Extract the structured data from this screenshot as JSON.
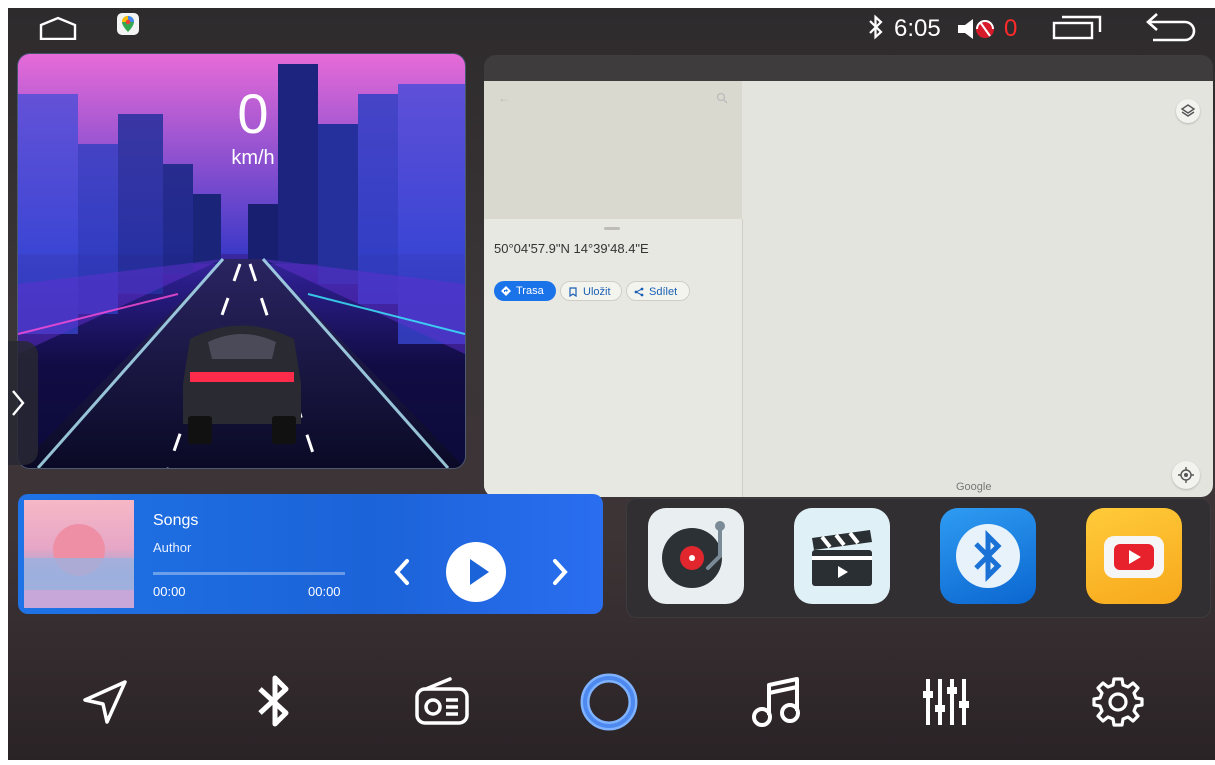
{
  "status_bar": {
    "time": "6:05",
    "volume_level": "0"
  },
  "speedometer": {
    "speed": "0",
    "unit": "km/h"
  },
  "map": {
    "coordinates": "50°04'57.9\"N 14°39'48.4\"E",
    "actions": {
      "route": "Trasa",
      "save": "Uložit",
      "share": "Sdílet"
    },
    "logo": "Google"
  },
  "music": {
    "title": "Songs",
    "author": "Author",
    "time_current": "00:00",
    "time_total": "00:00",
    "progress": 0
  },
  "apps": [
    "vinyl-player-icon",
    "video-clapper-icon",
    "bluetooth-icon",
    "youtube-icon"
  ],
  "dock": [
    "navigation-icon",
    "bluetooth-icon",
    "radio-icon",
    "home-circle-icon",
    "music-note-icon",
    "equalizer-icon",
    "settings-gear-icon"
  ],
  "colors": {
    "accent_blue": "#1a73e8",
    "music_card": "#1f73e6",
    "alert_red": "#ff2a2a"
  }
}
